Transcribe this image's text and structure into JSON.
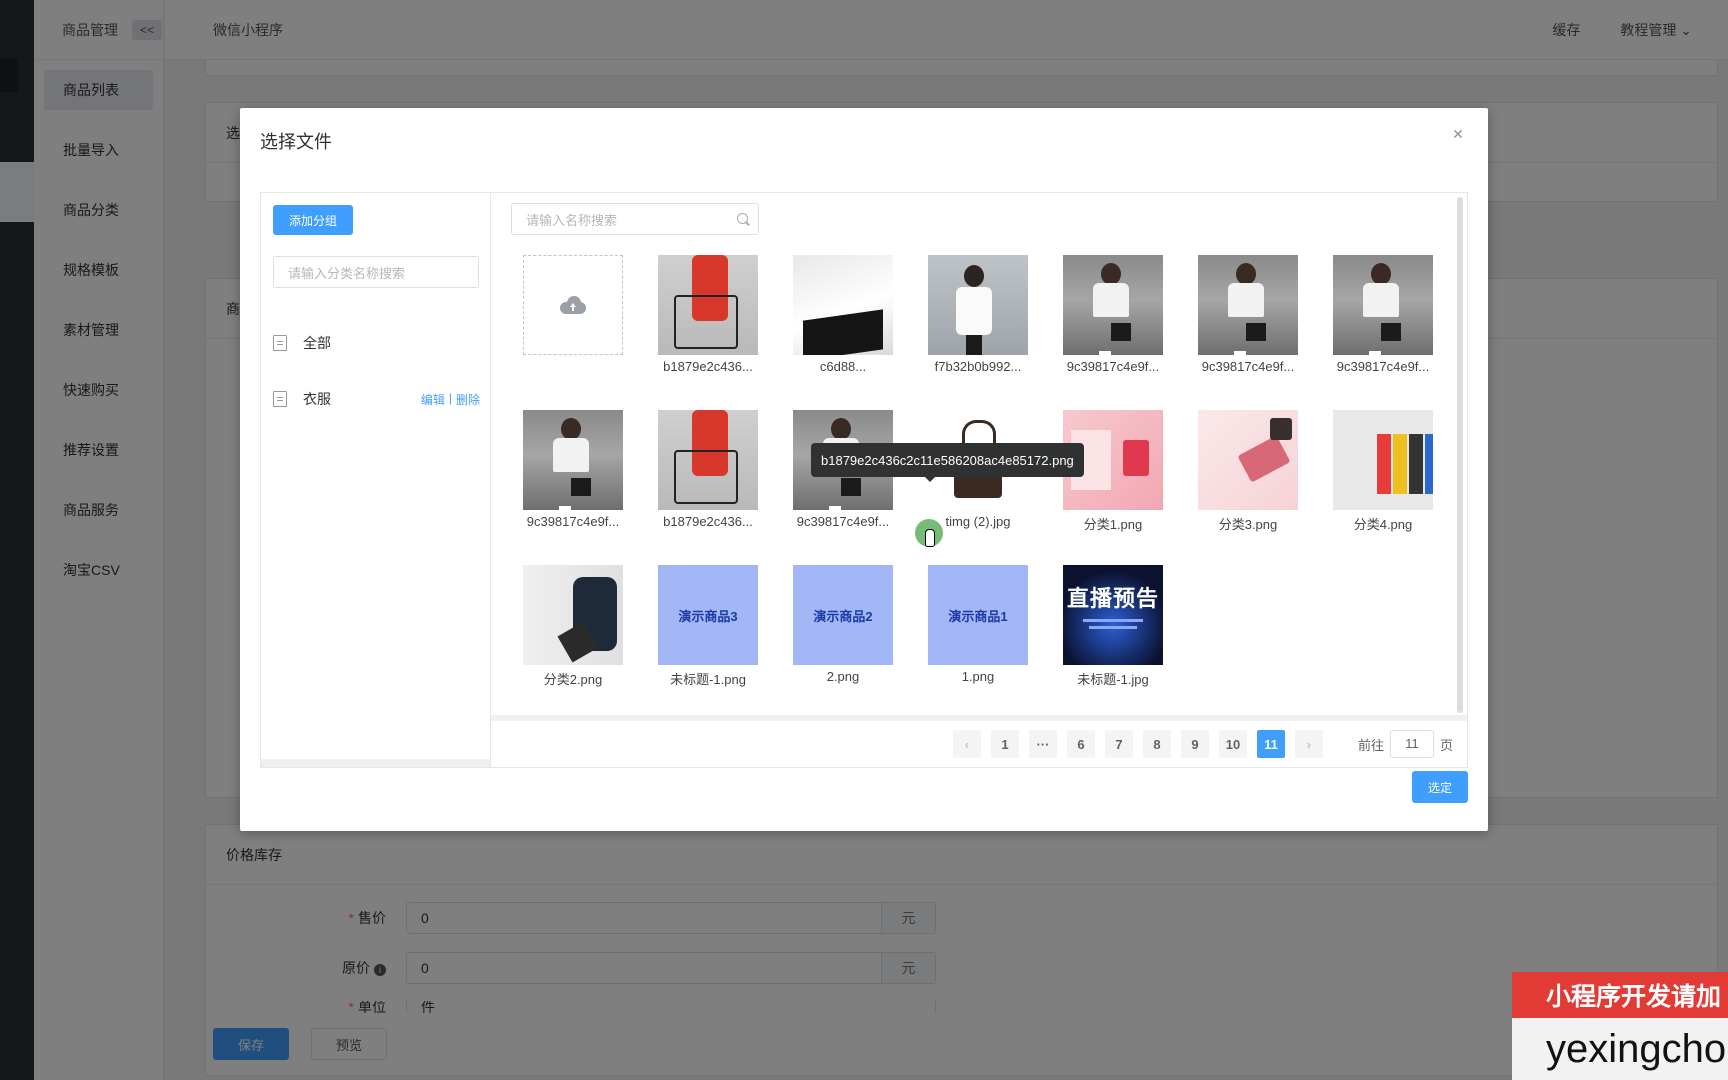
{
  "app": {
    "module_title": "商品管理",
    "collapse_label": "<<",
    "header_title": "微信小程序",
    "header_right": [
      "缓存",
      "教程管理"
    ]
  },
  "subnav": {
    "items": [
      "商品列表",
      "批量导入",
      "商品分类",
      "规格模板",
      "素材管理",
      "快速购买",
      "推荐设置",
      "商品服务",
      "淘宝CSV"
    ],
    "active_index": 0
  },
  "background_form": {
    "section_partial_1": "选",
    "section_partial_2": "商",
    "price_section_title": "价格库存",
    "rows": [
      {
        "label": "售价",
        "required": true,
        "value": "0",
        "unit": "元"
      },
      {
        "label": "原价",
        "required": false,
        "info_icon": true,
        "value": "0",
        "unit": "元"
      },
      {
        "label": "单位",
        "required": true,
        "value": "件",
        "unit": ""
      }
    ],
    "save_label": "保存",
    "preview_label": "预览"
  },
  "dialog": {
    "title": "选择文件",
    "add_group_label": "添加分组",
    "group_search_placeholder": "请输入分类名称搜索",
    "groups": [
      {
        "name": "全部",
        "actions": []
      },
      {
        "name": "衣服",
        "actions": [
          "编辑",
          "删除"
        ]
      }
    ],
    "file_search_placeholder": "请输入名称搜索",
    "tooltip": "b1879e2c436c2c11e586208ac4e85172.png",
    "files": [
      {
        "name": "",
        "kind": "upload"
      },
      {
        "name": "b1879e2c436...",
        "kind": "red-pants"
      },
      {
        "name": "c6d88...",
        "kind": "white-top"
      },
      {
        "name": "f7b32b0b992...",
        "kind": "street"
      },
      {
        "name": "9c39817c4e9f...",
        "kind": "girl"
      },
      {
        "name": "9c39817c4e9f...",
        "kind": "girl"
      },
      {
        "name": "9c39817c4e9f...",
        "kind": "girl"
      },
      {
        "name": "9c39817c4e9f...",
        "kind": "girl"
      },
      {
        "name": "b1879e2c436...",
        "kind": "red-pants"
      },
      {
        "name": "9c39817c4e9f...",
        "kind": "girl"
      },
      {
        "name": "timg (2).jpg",
        "kind": "bag"
      },
      {
        "name": "分类1.png",
        "kind": "pink"
      },
      {
        "name": "分类3.png",
        "kind": "wallet"
      },
      {
        "name": "分类4.png",
        "kind": "luggage"
      },
      {
        "name": "分类2.png",
        "kind": "backpack"
      },
      {
        "name": "未标题-1.png",
        "kind": "blue",
        "thumb_text": "演示商品3"
      },
      {
        "name": "2.png",
        "kind": "blue",
        "thumb_text": "演示商品2"
      },
      {
        "name": "1.png",
        "kind": "blue",
        "thumb_text": "演示商品1"
      },
      {
        "name": "未标题-1.jpg",
        "kind": "live",
        "thumb_text": "直播预告"
      }
    ],
    "pagination": {
      "pages": [
        "1",
        "···",
        "6",
        "7",
        "8",
        "9",
        "10",
        "11"
      ],
      "current": "11",
      "goto_prefix": "前往",
      "goto_value": "11",
      "goto_suffix": "页"
    },
    "confirm_label": "选定"
  },
  "watermark": {
    "line1": "小程序开发请加",
    "line2": "yexingchon"
  },
  "colors": {
    "primary": "#409eff",
    "overlay": "rgba(0,0,0,0.5)",
    "watermark_red": "#e23a35"
  }
}
